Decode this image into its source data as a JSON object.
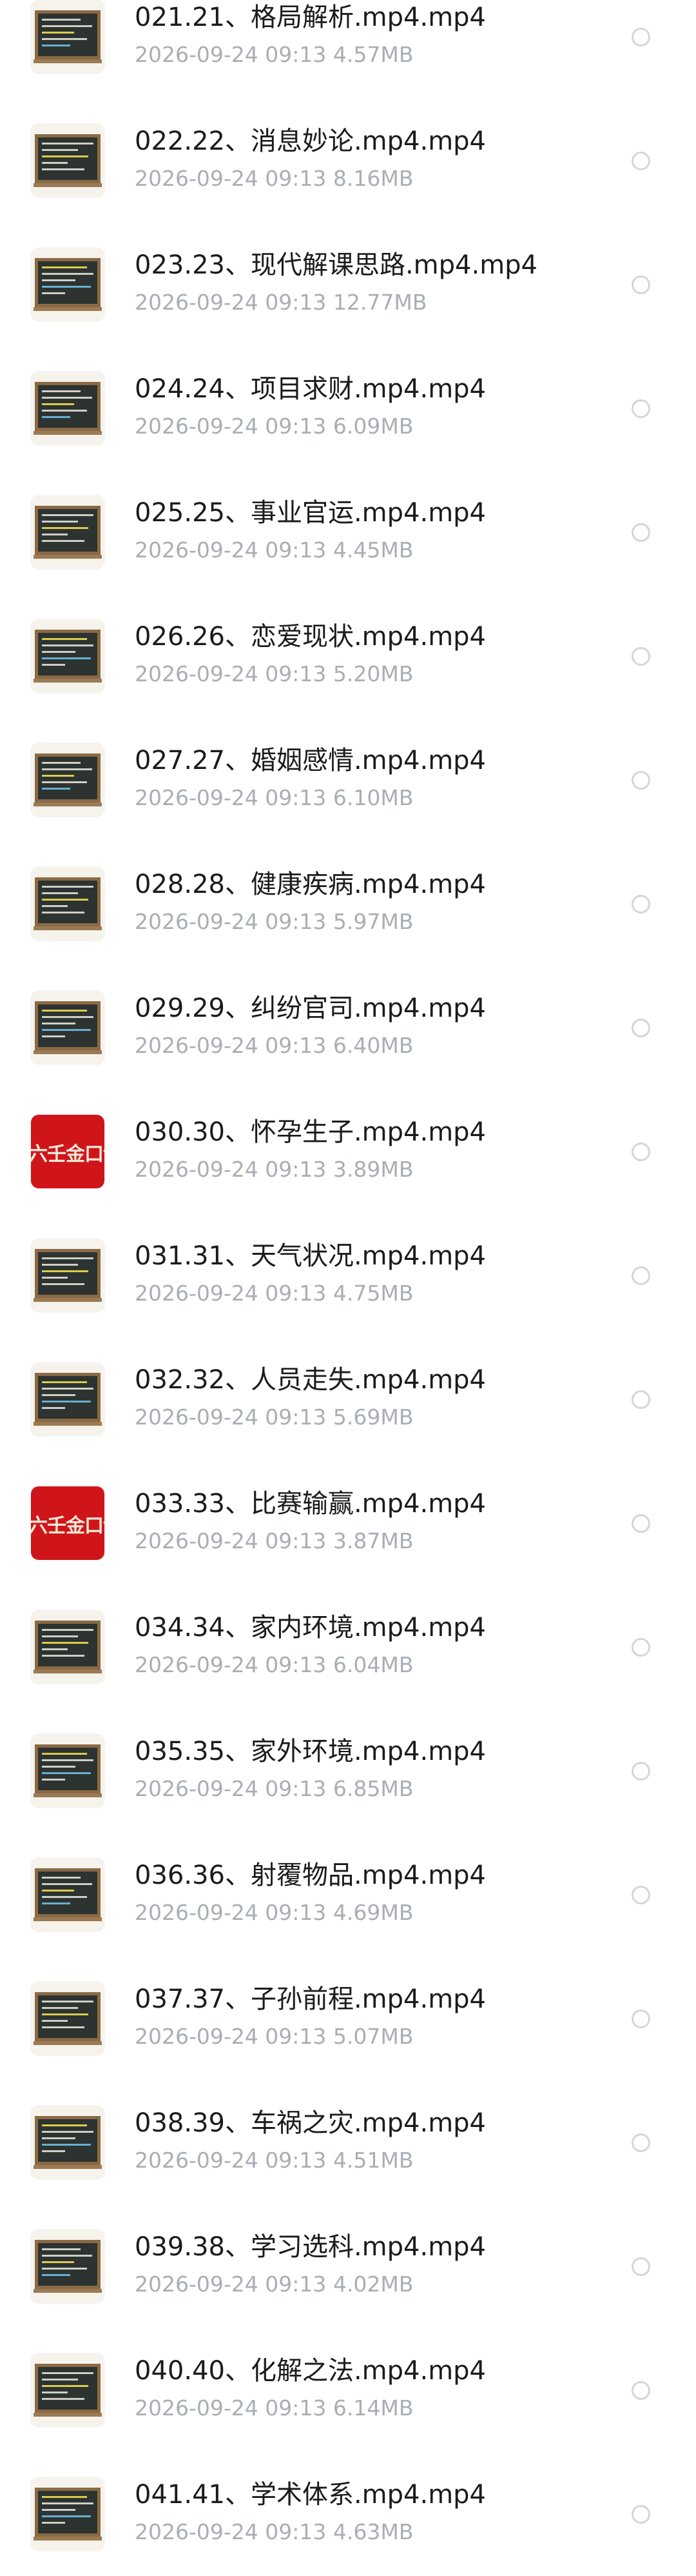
{
  "files": [
    {
      "name": "021.21、格局解析.mp4.mp4",
      "date": "2026-09-24",
      "time": "09:13",
      "size": "4.57MB",
      "thumbnail": "chalkboard"
    },
    {
      "name": "022.22、消息妙论.mp4.mp4",
      "date": "2026-09-24",
      "time": "09:13",
      "size": "8.16MB",
      "thumbnail": "chalkboard"
    },
    {
      "name": "023.23、现代解课思路.mp4.mp4",
      "date": "2026-09-24",
      "time": "09:13",
      "size": "12.77MB",
      "thumbnail": "chalkboard"
    },
    {
      "name": "024.24、项目求财.mp4.mp4",
      "date": "2026-09-24",
      "time": "09:13",
      "size": "6.09MB",
      "thumbnail": "chalkboard"
    },
    {
      "name": "025.25、事业官运.mp4.mp4",
      "date": "2026-09-24",
      "time": "09:13",
      "size": "4.45MB",
      "thumbnail": "chalkboard"
    },
    {
      "name": "026.26、恋爱现状.mp4.mp4",
      "date": "2026-09-24",
      "time": "09:13",
      "size": "5.20MB",
      "thumbnail": "chalkboard"
    },
    {
      "name": "027.27、婚姻感情.mp4.mp4",
      "date": "2026-09-24",
      "time": "09:13",
      "size": "6.10MB",
      "thumbnail": "chalkboard"
    },
    {
      "name": "028.28、健康疾病.mp4.mp4",
      "date": "2026-09-24",
      "time": "09:13",
      "size": "5.97MB",
      "thumbnail": "chalkboard"
    },
    {
      "name": "029.29、纠纷官司.mp4.mp4",
      "date": "2026-09-24",
      "time": "09:13",
      "size": "6.40MB",
      "thumbnail": "chalkboard"
    },
    {
      "name": "030.30、怀孕生子.mp4.mp4",
      "date": "2026-09-24",
      "time": "09:13",
      "size": "3.89MB",
      "thumbnail": "red-cover",
      "cover_text": "六壬金口诀"
    },
    {
      "name": "031.31、天气状况.mp4.mp4",
      "date": "2026-09-24",
      "time": "09:13",
      "size": "4.75MB",
      "thumbnail": "chalkboard"
    },
    {
      "name": "032.32、人员走失.mp4.mp4",
      "date": "2026-09-24",
      "time": "09:13",
      "size": "5.69MB",
      "thumbnail": "chalkboard"
    },
    {
      "name": "033.33、比赛输赢.mp4.mp4",
      "date": "2026-09-24",
      "time": "09:13",
      "size": "3.87MB",
      "thumbnail": "red-cover",
      "cover_text": "六壬金口诀"
    },
    {
      "name": "034.34、家内环境.mp4.mp4",
      "date": "2026-09-24",
      "time": "09:13",
      "size": "6.04MB",
      "thumbnail": "chalkboard"
    },
    {
      "name": "035.35、家外环境.mp4.mp4",
      "date": "2026-09-24",
      "time": "09:13",
      "size": "6.85MB",
      "thumbnail": "chalkboard"
    },
    {
      "name": "036.36、射覆物品.mp4.mp4",
      "date": "2026-09-24",
      "time": "09:13",
      "size": "4.69MB",
      "thumbnail": "chalkboard"
    },
    {
      "name": "037.37、子孙前程.mp4.mp4",
      "date": "2026-09-24",
      "time": "09:13",
      "size": "5.07MB",
      "thumbnail": "chalkboard"
    },
    {
      "name": "038.39、车祸之灾.mp4.mp4",
      "date": "2026-09-24",
      "time": "09:13",
      "size": "4.51MB",
      "thumbnail": "chalkboard"
    },
    {
      "name": "039.38、学习选科.mp4.mp4",
      "date": "2026-09-24",
      "time": "09:13",
      "size": "4.02MB",
      "thumbnail": "chalkboard"
    },
    {
      "name": "040.40、化解之法.mp4.mp4",
      "date": "2026-09-24",
      "time": "09:13",
      "size": "6.14MB",
      "thumbnail": "chalkboard"
    },
    {
      "name": "041.41、学术体系.mp4.mp4",
      "date": "2026-09-24",
      "time": "09:13",
      "size": "4.63MB",
      "thumbnail": "chalkboard"
    }
  ],
  "colors": {
    "name_text": "#1b1b1b",
    "meta_text": "#a9aeb6",
    "radio_border": "#d3d6db",
    "red_cover": "#d0151a"
  }
}
